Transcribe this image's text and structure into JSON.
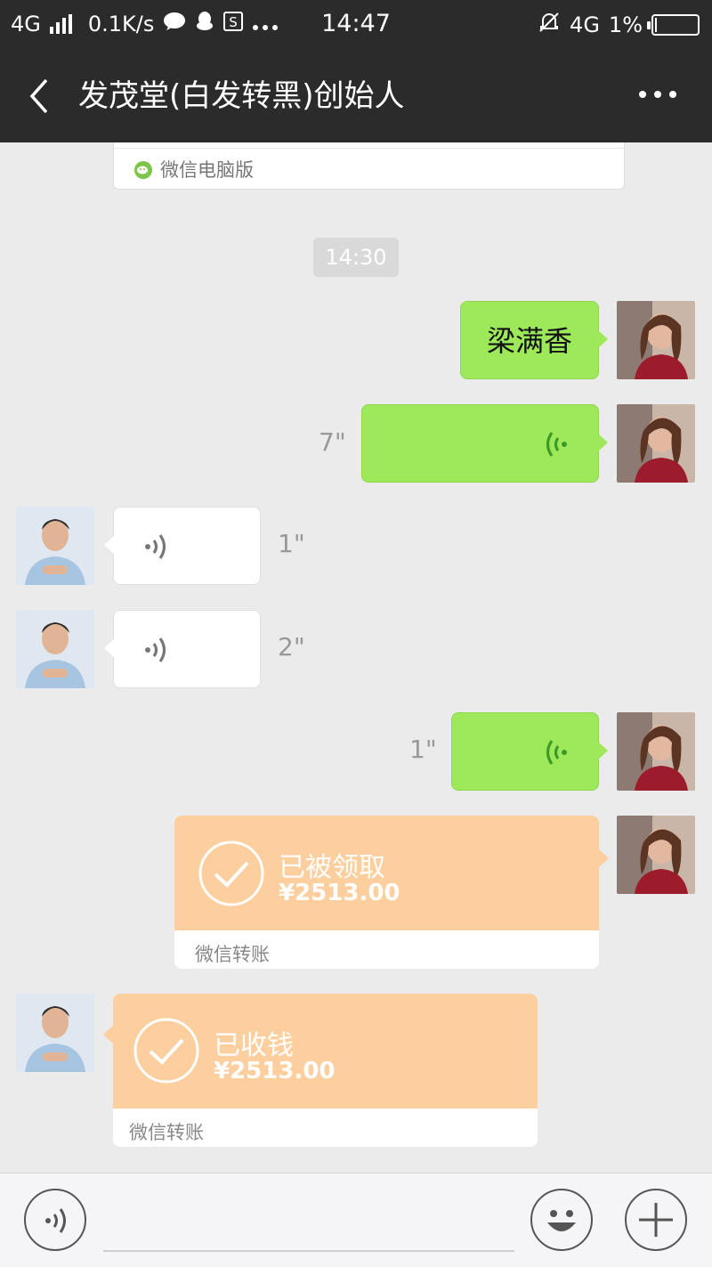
{
  "status_bar": {
    "network": "4G",
    "speed": "0.1K/s",
    "time": "14:47",
    "network_right": "4G",
    "battery": "1%"
  },
  "header": {
    "title": "发茂堂(白发转黑)创始人",
    "back_icon": "back-arrow-icon",
    "more_icon": "more-icon"
  },
  "chat": {
    "card_label": "微信电脑版",
    "timestamp": "14:30",
    "messages": [
      {
        "type": "text",
        "side": "right",
        "text": "梁满香"
      },
      {
        "type": "voice",
        "side": "right",
        "duration": "7\""
      },
      {
        "type": "voice",
        "side": "left",
        "duration": "1\""
      },
      {
        "type": "voice",
        "side": "left",
        "duration": "2\""
      },
      {
        "type": "voice",
        "side": "right",
        "duration": "1\""
      },
      {
        "type": "transfer",
        "side": "right",
        "status": "已被领取",
        "amount": "¥2513.00",
        "footer": "微信转账"
      },
      {
        "type": "transfer",
        "side": "left",
        "status": "已收钱",
        "amount": "¥2513.00",
        "footer": "微信转账"
      }
    ]
  },
  "input_bar": {
    "voice_icon": "voice-input-icon",
    "emoji_icon": "emoji-icon",
    "plus_icon": "plus-icon"
  },
  "colors": {
    "header_bg": "#2b2b2b",
    "chat_bg": "#ebebeb",
    "bubble_green": "#9ee95a",
    "transfer_orange": "#fdcf9e"
  }
}
